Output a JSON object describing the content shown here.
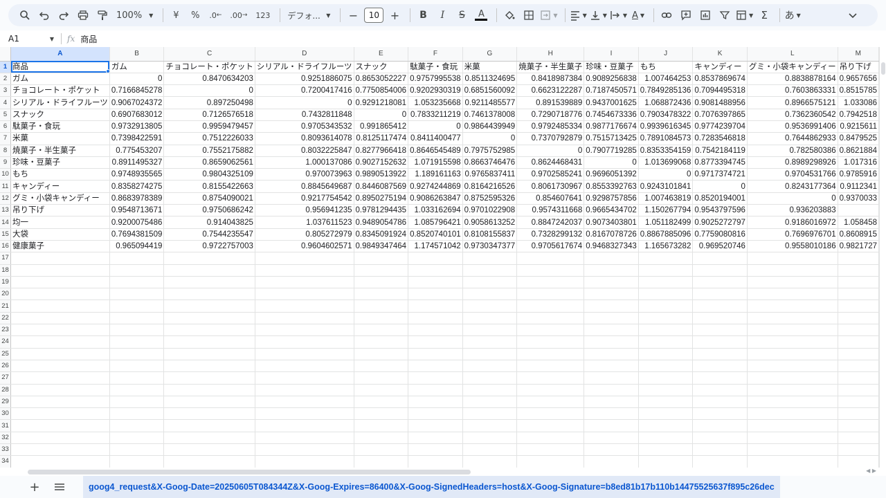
{
  "toolbar": {
    "zoom": "100%",
    "currency": "¥",
    "percent": "%",
    "dec_decrease": ".0",
    "dec_increase": ".00",
    "number_format": "123",
    "font_name": "デフォ...",
    "font_size": "10",
    "ime": "あ"
  },
  "formula_bar": {
    "cell_ref": "A1",
    "fx": "fx",
    "content": "商品"
  },
  "columns": [
    "A",
    "B",
    "C",
    "D",
    "E",
    "F",
    "G",
    "H",
    "I",
    "J",
    "K",
    "L",
    "M"
  ],
  "rows": [
    [
      "商品",
      "ガム",
      "チョコレート・ポケット",
      "シリアル・ドライフルーツ",
      "スナック",
      "駄菓子・食玩",
      "米菓",
      "焼菓子・半生菓子",
      "珍味・豆菓子",
      "もち",
      "キャンディー",
      "グミ・小袋キャンディー",
      "吊り下げ"
    ],
    [
      "ガム",
      "0",
      "0.8470634203",
      "0.9251886075",
      "0.8653052227",
      "0.9757995538",
      "0.8511324695",
      "0.8418987384",
      "0.9089256838",
      "1.007464253",
      "0.8537869674",
      "0.8838878164",
      "0.9657656"
    ],
    [
      "チョコレート・ポケット",
      "0.7166845278",
      "0",
      "0.7200417416",
      "0.7750854006",
      "0.9202930319",
      "0.6851560092",
      "0.6623122287",
      "0.7187450571",
      "0.7849285136",
      "0.7094495318",
      "0.7603863331",
      "0.8515785"
    ],
    [
      "シリアル・ドライフルーツ",
      "0.9067024372",
      "0.897250498",
      "0",
      "0.9291218081",
      "1.053235668",
      "0.9211485577",
      "0.891539889",
      "0.9437001625",
      "1.068872436",
      "0.9081488956",
      "0.8966575121",
      "1.033086"
    ],
    [
      "スナック",
      "0.6907683012",
      "0.7126576518",
      "0.7432811848",
      "0",
      "0.7833211219",
      "0.7461378008",
      "0.7290718776",
      "0.7454673336",
      "0.7903478322",
      "0.7076397865",
      "0.7362360542",
      "0.7942518"
    ],
    [
      "駄菓子・食玩",
      "0.9732913805",
      "0.9959479457",
      "0.9705343532",
      "0.991865412",
      "0",
      "0.9864439949",
      "0.9792485334",
      "0.9877176674",
      "0.9939616345",
      "0.9774239704",
      "0.9536991406",
      "0.9215611"
    ],
    [
      "米菓",
      "0.7398422591",
      "0.7512226033",
      "0.8093614078",
      "0.8125117474",
      "0.8411400477",
      "0",
      "0.7370792879",
      "0.7515713425",
      "0.7891084573",
      "0.7283546818",
      "0.7644862933",
      "0.8479525"
    ],
    [
      "焼菓子・半生菓子",
      "0.775453207",
      "0.7552175882",
      "0.8032225847",
      "0.8277966418",
      "0.8646545489",
      "0.7975752985",
      "0",
      "0.7907719285",
      "0.8353354159",
      "0.7542184119",
      "0.782580386",
      "0.8621884"
    ],
    [
      "珍味・豆菓子",
      "0.8911495327",
      "0.8659062561",
      "1.000137086",
      "0.9027152632",
      "1.071915598",
      "0.8663746476",
      "0.8624468431",
      "0",
      "1.013699068",
      "0.8773394745",
      "0.8989298926",
      "1.017316"
    ],
    [
      "もち",
      "0.9748935565",
      "0.9804325109",
      "0.970073963",
      "0.9890513922",
      "1.189161163",
      "0.9765837411",
      "0.9702585241",
      "0.9696051392",
      "0",
      "0.9717374721",
      "0.9704531766",
      "0.9785916"
    ],
    [
      "キャンディー",
      "0.8358274275",
      "0.8155422663",
      "0.8845649687",
      "0.8446087569",
      "0.9274244869",
      "0.8164216526",
      "0.8061730967",
      "0.8553392763",
      "0.9243101841",
      "0",
      "0.8243177364",
      "0.9112341"
    ],
    [
      "グミ・小袋キャンディー",
      "0.8683978389",
      "0.8754090021",
      "0.9217754542",
      "0.8950275194",
      "0.9086263847",
      "0.8752595326",
      "0.854607641",
      "0.9298757856",
      "1.007463819",
      "0.8520194001",
      "0",
      "0.9370033"
    ],
    [
      "吊り下げ",
      "0.9548713671",
      "0.9750686242",
      "0.956941235",
      "0.9781294435",
      "1.033162694",
      "0.9701022908",
      "0.9574311668",
      "0.9665434702",
      "1.150267794",
      "0.9543797596",
      "0.936203883",
      ""
    ],
    [
      "均一",
      "0.9200075486",
      "0.914043825",
      "1.037611523",
      "0.9489054786",
      "1.085796421",
      "0.9058613252",
      "0.8847242037",
      "0.9073403801",
      "1.051182499",
      "0.9025272797",
      "0.9186016972",
      "1.058458"
    ],
    [
      "大袋",
      "0.7694381509",
      "0.7544235547",
      "0.805272979",
      "0.8345091924",
      "0.8520740101",
      "0.8108155837",
      "0.7328299132",
      "0.8167078726",
      "0.8867885096",
      "0.7759080816",
      "0.7696976701",
      "0.8608915"
    ],
    [
      "健康菓子",
      "0.965094419",
      "0.9722757003",
      "0.9604602571",
      "0.9849347464",
      "1.174571042",
      "0.9730347377",
      "0.9705617674",
      "0.9468327343",
      "1.165673282",
      "0.969520746",
      "0.9558010186",
      "0.9821727"
    ]
  ],
  "total_rows": 34,
  "sheet_tab": "goog4_request&X-Goog-Date=20250605T084344Z&X-Goog-Expires=86400&X-Goog-SignedHeaders=host&X-Goog-Signature=b8ed81b17b110b14475525637f895c26dec"
}
